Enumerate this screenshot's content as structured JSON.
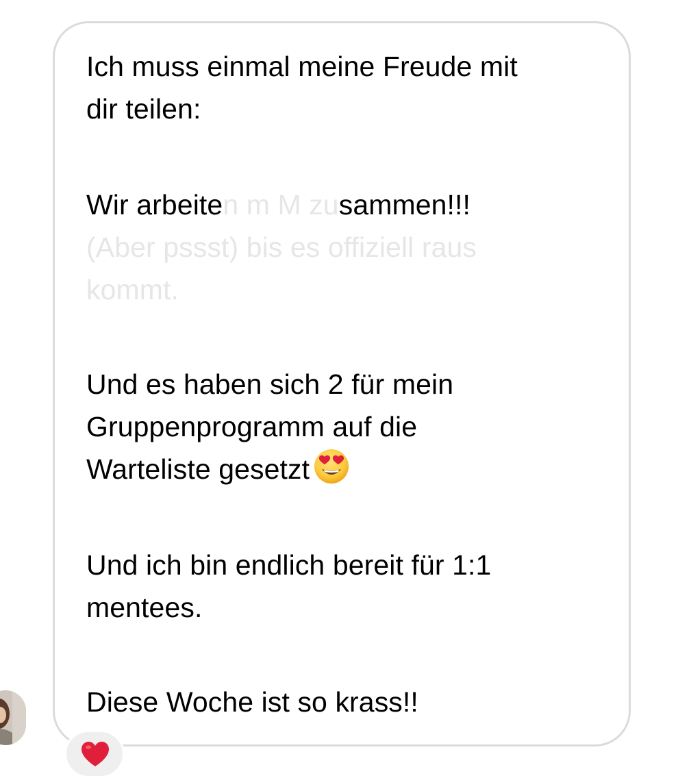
{
  "message": {
    "lines": {
      "l1": "Ich muss einmal meine Freude mit",
      "l2": "dir teilen:",
      "l3_visible_start": "Wir arbeite",
      "l3_faded": "n m   M zu",
      "l3_visible_end": "sammen!!!",
      "l4_faded": "(Aber pssst) bis es offiziell raus",
      "l5_faded": "kommt.",
      "l6": "Und es haben sich 2 für mein",
      "l7": "Gruppenprogramm auf die",
      "l8": "Warteliste gesetzt",
      "l9": "Und ich bin endlich bereit für 1:1",
      "l10": "mentees.",
      "l11": "Diese Woche ist so krass!!"
    },
    "emoji": "heart-eyes-emoji"
  },
  "reaction": {
    "emoji": "red-heart-icon"
  },
  "colors": {
    "text": "#000000",
    "faded_text": "#e6e6e6",
    "bubble_border": "#dbdbdb",
    "reaction_bg": "#efefef",
    "heart": "#e0203a"
  }
}
